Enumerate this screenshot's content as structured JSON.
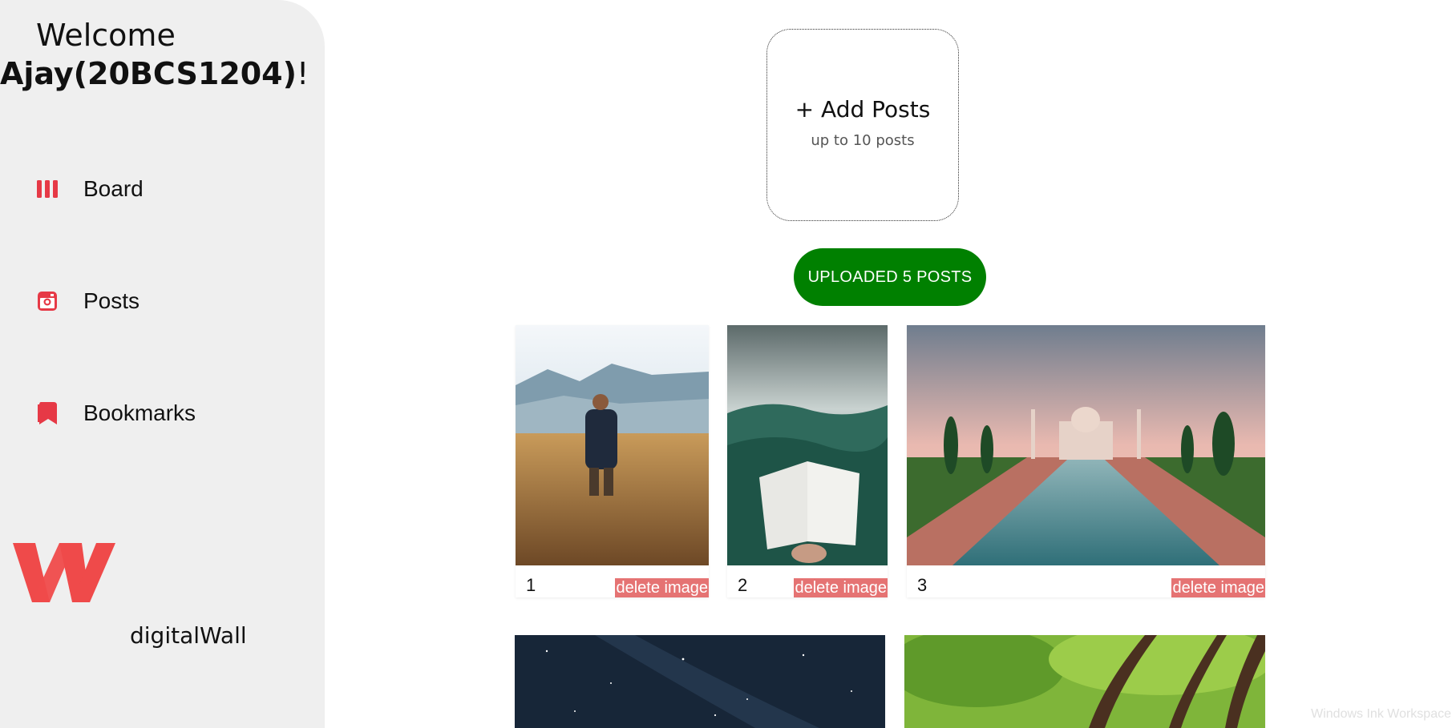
{
  "sidebar": {
    "welcome": "Welcome",
    "username": "Ajay(20BCS1204)",
    "exclaim": "!",
    "nav": [
      {
        "label": "Board",
        "icon": "board-columns-icon"
      },
      {
        "label": "Posts",
        "icon": "instagram-icon"
      },
      {
        "label": "Bookmarks",
        "icon": "bookmark-icon"
      }
    ],
    "logo_icon": "w-logo-icon",
    "brand": "digitalWall",
    "accent_color": "#e63946"
  },
  "main": {
    "add_posts": {
      "title": "+ Add Posts",
      "subtitle": "up to 10 posts"
    },
    "uploaded_button": "UPLOADED 5 POSTS",
    "uploaded_color": "#008000",
    "posts": [
      {
        "number": "1",
        "delete_label": "delete image",
        "image": "man-in-wheat-field"
      },
      {
        "number": "2",
        "delete_label": "delete image",
        "image": "open-book-forest"
      },
      {
        "number": "3",
        "delete_label": "delete image",
        "image": "taj-mahal"
      },
      {
        "image": "starry-night-sky"
      },
      {
        "image": "green-trees"
      }
    ]
  },
  "overlay": {
    "watermark": "Windows Ink Workspace"
  }
}
